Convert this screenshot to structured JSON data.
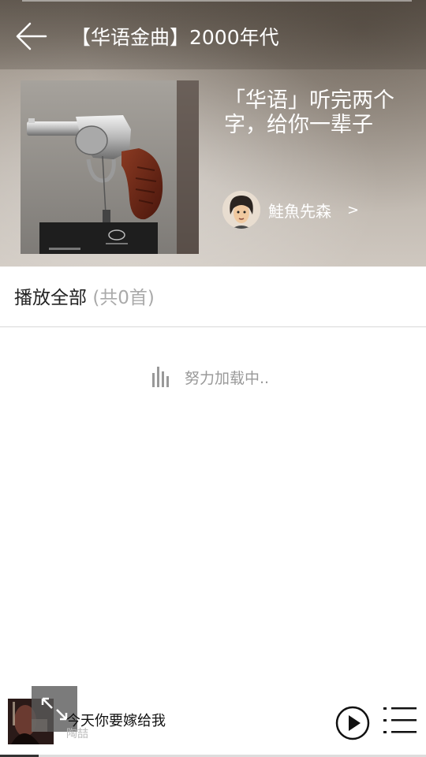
{
  "header": {
    "title": "【华语金曲】2000年代",
    "back_icon": "arrow-left-icon"
  },
  "playlist": {
    "description": "「华语」听完两个字，给你一辈子",
    "creator_name": "鮭魚先森",
    "creator_arrow": ">"
  },
  "play_all": {
    "label": "播放全部",
    "count": "(共0首)"
  },
  "loading": {
    "text": "努力加载中..",
    "icon": "equalizer-icon"
  },
  "player": {
    "song": "今天你要嫁给我",
    "artist": "陶喆",
    "progress": 0.09,
    "play_icon": "play-icon",
    "list_icon": "playlist-icon",
    "expand_icon": "expand-icon"
  },
  "colors": {
    "hero_tint": "#a79e94",
    "text_light": "#ffffff",
    "muted": "#999999"
  }
}
